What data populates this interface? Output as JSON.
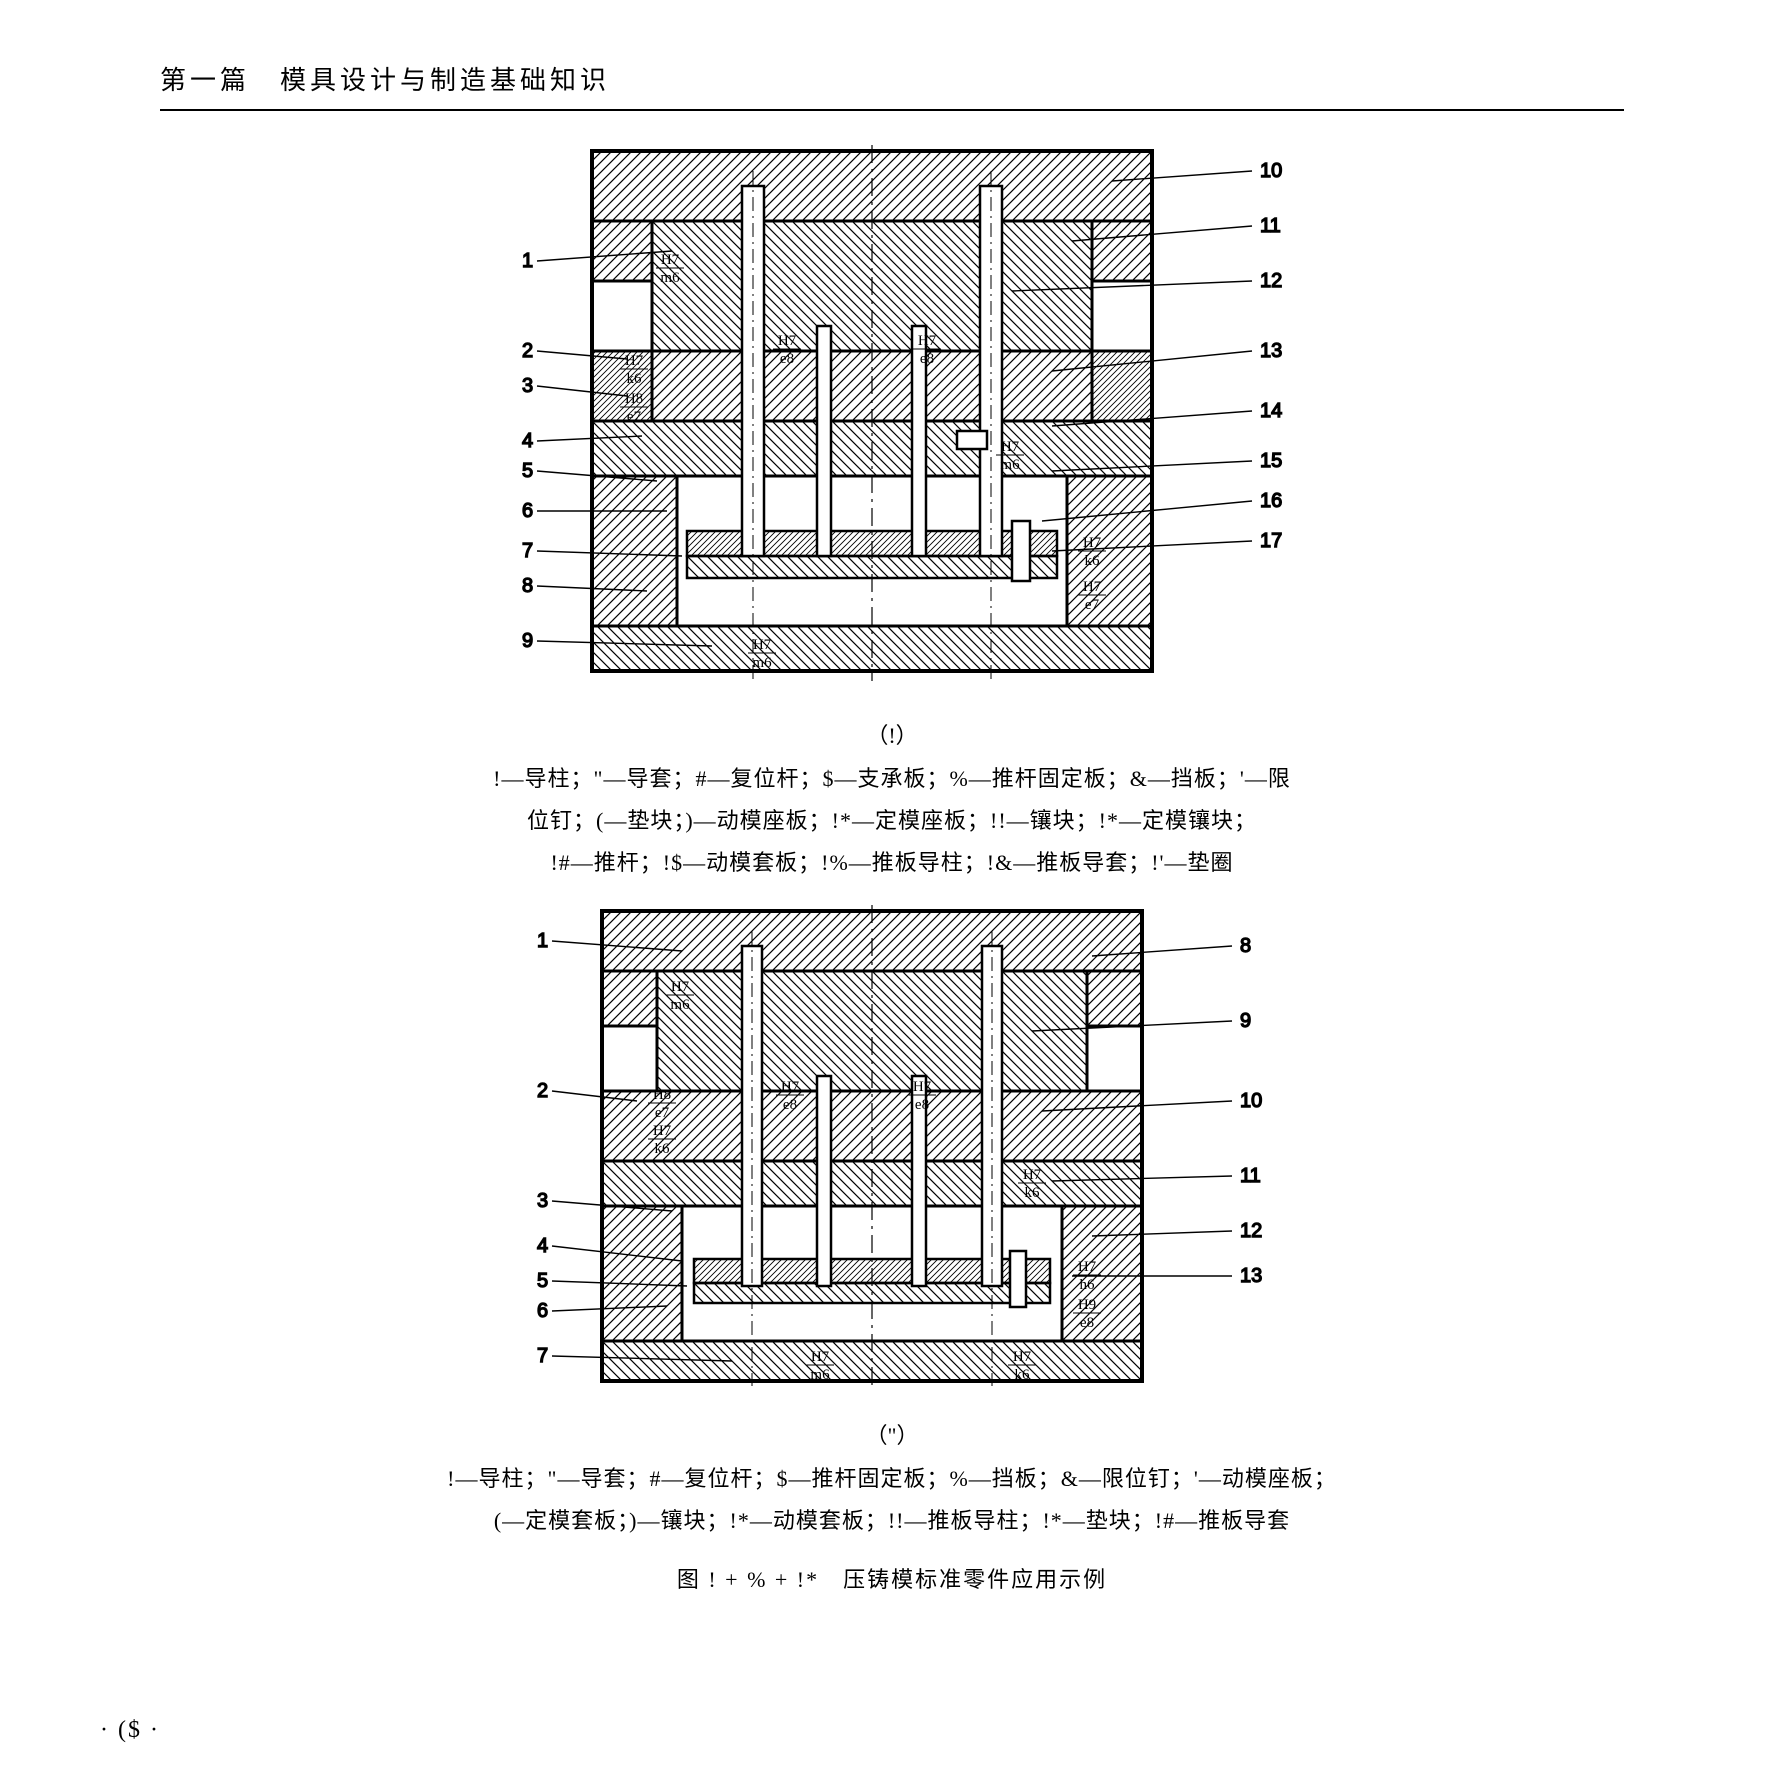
{
  "header": {
    "title": "第一篇　模具设计与制造基础知识"
  },
  "fig_a": {
    "sublabel": "（!）",
    "callouts_left": [
      "1",
      "2",
      "3",
      "4",
      "5",
      "6",
      "7",
      "8",
      "9"
    ],
    "callouts_right": [
      "10",
      "11",
      "12",
      "13",
      "14",
      "15",
      "16",
      "17"
    ],
    "tolerances": {
      "t1": "H7",
      "b1": "m6",
      "t2": "H7",
      "b2": "k6",
      "t3": "H8",
      "b3": "e7",
      "t4": "H7",
      "b4": "e8",
      "t5": "H7",
      "b5": "e8",
      "t6": "H7",
      "b6": "m6",
      "t7": "H7",
      "b7": "k6",
      "t8": "H7",
      "b8": "e7",
      "t9": "H7",
      "b9": "m6"
    },
    "legend_l1": "!—导柱；\"—导套；#—复位杆；$—支承板；%—推杆固定板；&—挡板；'—限",
    "legend_l2": "位钉；(—垫块；)—动模座板；!*—定模座板；!!—镶块；!*—定模镶块；",
    "legend_l3": "!#—推杆；!$—动模套板；!%—推板导柱；!&—推板导套；!'—垫圈"
  },
  "fig_b": {
    "sublabel": "（\"）",
    "callouts_left": [
      "1",
      "2",
      "3",
      "4",
      "5",
      "6",
      "7"
    ],
    "callouts_right": [
      "8",
      "9",
      "10",
      "11",
      "12",
      "13"
    ],
    "tolerances": {
      "t1": "H7",
      "b1": "m6",
      "t2": "H8",
      "b2": "e7",
      "t3": "H7",
      "b3": "k6",
      "t4": "H7",
      "b4": "e8",
      "t5": "H7",
      "b5": "e8",
      "t6": "H7",
      "b6": "k6",
      "t7": "H7",
      "b7": "h6",
      "t8": "H9",
      "b8": "e8",
      "t9": "H7",
      "b9": "m6",
      "t10": "H7",
      "b10": "k6"
    },
    "legend_l1": "!—导柱；\"—导套；#—复位杆；$—推杆固定板；%—挡板；&—限位钉；'—动模座板；",
    "legend_l2": "(—定模套板；)—镶块；!*—动模套板；!!—推板导柱；!*—垫块；!#—推板导套"
  },
  "caption": "图 ! + % + !*　压铸模标准零件应用示例",
  "page_number": "· ($ ·"
}
